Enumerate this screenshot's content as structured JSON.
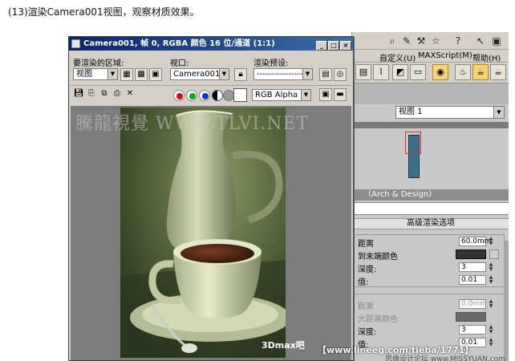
{
  "caption": "(13)渲染Camera001视图，观察材质效果。",
  "render_window": {
    "title": "Camera001, 帧 0, RGBA 颜色 16 位/通道 (1:1)",
    "title_buttons": [
      "_",
      "□",
      "×"
    ],
    "area_label": "要渲染的区域:",
    "area_value": "视图",
    "viewport_label": "视口:",
    "viewport_value": "Camera001",
    "preset_label": "渲染预设:",
    "preset_value": "-------------------",
    "channel_value": "RGB Alpha",
    "channel_colors": [
      "#d01010",
      "#10a020",
      "#1030d0"
    ],
    "image_description_colors": {
      "background": "#3d4a26",
      "ceramic": "#cfd6b0",
      "coffee": "#4a2414"
    }
  },
  "watermarks": {
    "site_cn": "騰龍視覺",
    "site_url": "WWW.TLVI.NET",
    "brand": "3Dmax吧",
    "url2": "【www.lineeg.com/tieba/1771】",
    "corner": "思缘设计论坛 www.MISSYUAN.com"
  },
  "max_ui": {
    "menus": [
      "自定义(U)",
      "MAXScript(M)",
      "帮助(H)"
    ],
    "view_select": "视图 1",
    "rollout_title": "（Arch & Design）",
    "rollout_subtitle": "高级渲染选项",
    "params": [
      {
        "label": "距离",
        "value": "60.0mm",
        "dim": false
      },
      {
        "label": "到末端颜色",
        "value": "",
        "dim": false,
        "swatch": true
      },
      {
        "label": "深度:",
        "value": "3",
        "dim": false
      },
      {
        "label": "值:",
        "value": "0.01",
        "dim": false
      }
    ],
    "params2": [
      {
        "label": "距离",
        "value": "0.0mm",
        "dim": true
      },
      {
        "label": "大距离颜色",
        "value": "",
        "dim": true,
        "swatch": true
      },
      {
        "label": "深度:",
        "value": "3",
        "dim": false
      },
      {
        "label": "值:",
        "value": "0.01",
        "dim": false
      }
    ]
  }
}
